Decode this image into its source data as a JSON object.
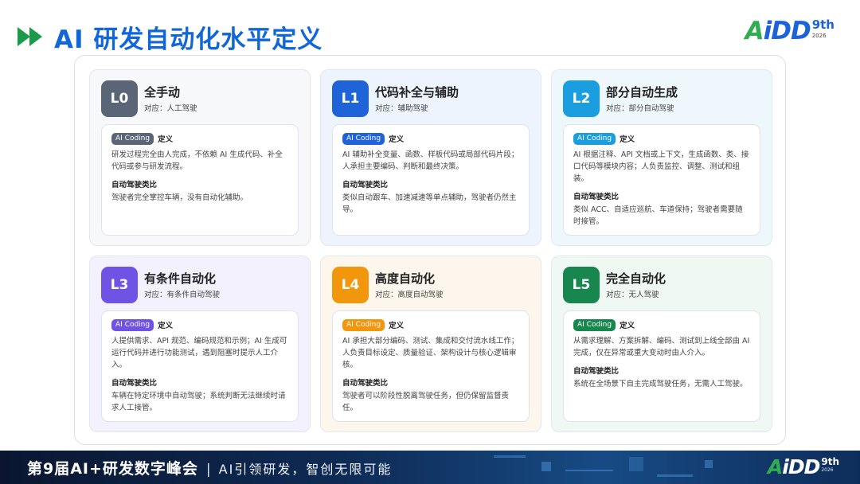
{
  "header": {
    "title": "AI 研发自动化水平定义",
    "logo": {
      "mark_a": "A",
      "mark_rest": "iDD",
      "edition": "9th",
      "year": "2026"
    }
  },
  "levels": [
    {
      "code": "L0",
      "name": "全手动",
      "correspond": "对应：人工驾驶",
      "tag": "AI Coding",
      "def_label": "定义",
      "definition": "研发过程完全由人完成，不依赖 AI 生成代码、补全代码或参与研发流程。",
      "analogy_label": "自动驾驶类比",
      "analogy": "驾驶者完全掌控车辆，没有自动化辅助。",
      "color": "#5a6577"
    },
    {
      "code": "L1",
      "name": "代码补全与辅助",
      "correspond": "对应：辅助驾驶",
      "tag": "AI Coding",
      "def_label": "定义",
      "definition": "AI 辅助补全变量、函数、样板代码或局部代码片段；人承担主要编码、判断和最终决策。",
      "analogy_label": "自动驾驶类比",
      "analogy": "类似自动跟车、加速减速等单点辅助，驾驶者仍然主导。",
      "color": "#1f63d8"
    },
    {
      "code": "L2",
      "name": "部分自动生成",
      "correspond": "对应：部分自动驾驶",
      "tag": "AI Coding",
      "def_label": "定义",
      "definition": "AI 根据注释、API 文档或上下文，生成函数、类、接口代码等模块内容；人负责监控、调整、测试和组装。",
      "analogy_label": "自动驾驶类比",
      "analogy": "类似 ACC、自适应巡航、车道保持；驾驶者需要随时接管。",
      "color": "#1a9ee0"
    },
    {
      "code": "L3",
      "name": "有条件自动化",
      "correspond": "对应：有条件自动驾驶",
      "tag": "AI Coding",
      "def_label": "定义",
      "definition": "人提供需求、API 规范、编码规范和示例；AI 生成可运行代码并进行功能测试，遇到阻塞时提示人工介入。",
      "analogy_label": "自动驾驶类比",
      "analogy": "车辆在特定环境中自动驾驶；系统判断无法继续时请求人工接管。",
      "color": "#7052e4"
    },
    {
      "code": "L4",
      "name": "高度自动化",
      "correspond": "对应：高度自动驾驶",
      "tag": "AI Coding",
      "def_label": "定义",
      "definition": "AI 承担大部分编码、测试、集成和交付流水线工作；人负责目标设定、质量验证、架构设计与核心逻辑审核。",
      "analogy_label": "自动驾驶类比",
      "analogy": "驾驶者可以阶段性脱离驾驶任务，但仍保留监督责任。",
      "color": "#f2960c"
    },
    {
      "code": "L5",
      "name": "完全自动化",
      "correspond": "对应：无人驾驶",
      "tag": "AI Coding",
      "def_label": "定义",
      "definition": "从需求理解、方案拆解、编码、测试到上线全部由 AI 完成，仅在异常或重大变动时由人介入。",
      "analogy_label": "自动驾驶类比",
      "analogy": "系统在全场景下自主完成驾驶任务，无需人工驾驶。",
      "color": "#18874f"
    }
  ],
  "footer": {
    "conference": "第9届AI+研发数字峰会",
    "separator": "|",
    "slogan": "AI引领研发，智创无限可能",
    "logo": {
      "mark_a": "A",
      "mark_rest": "iDD",
      "edition": "9th",
      "year": "2026"
    }
  }
}
